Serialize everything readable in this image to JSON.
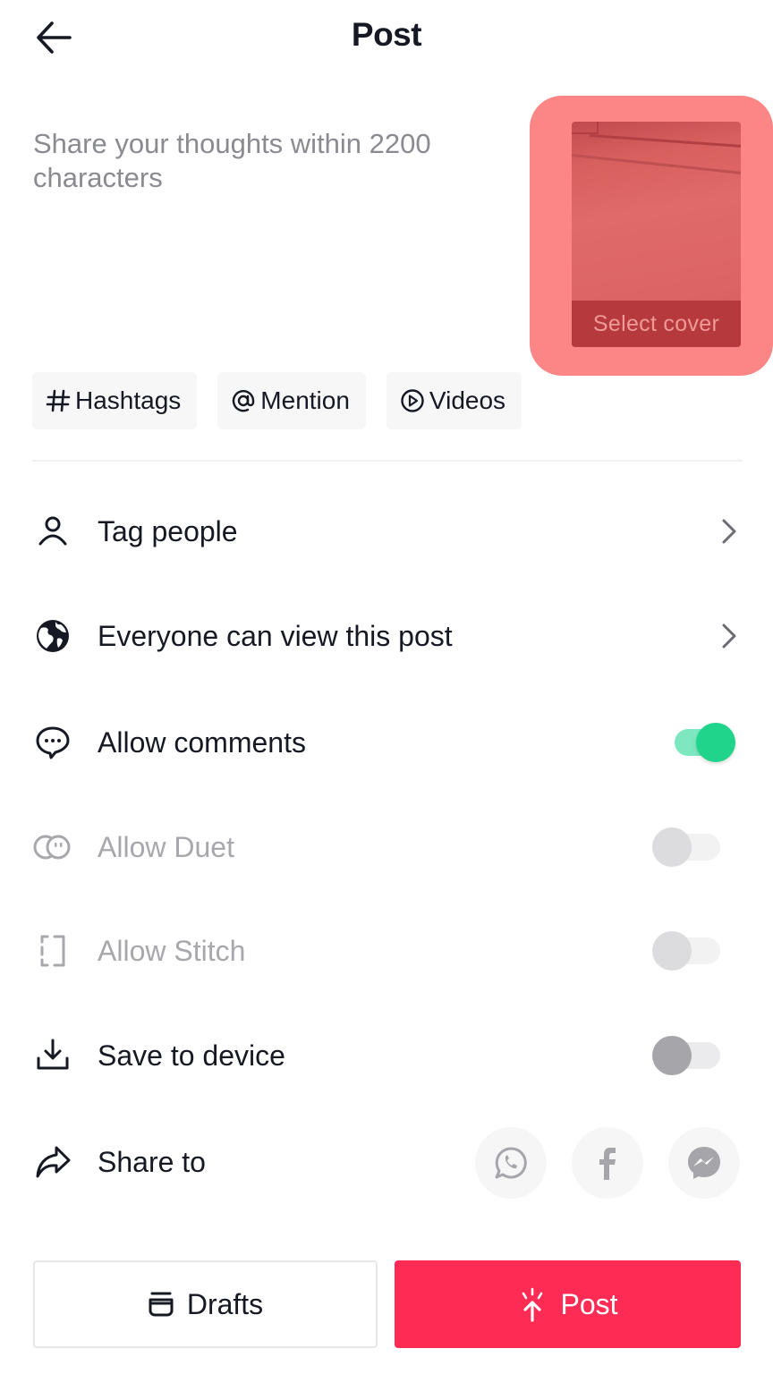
{
  "header": {
    "title": "Post",
    "back_icon": "arrow-left-icon"
  },
  "caption": {
    "placeholder": "Share your thoughts within 2200 characters",
    "value": ""
  },
  "cover": {
    "label": "Select cover",
    "highlight_color": "#fc8585"
  },
  "chips": [
    {
      "icon": "hashtag-icon",
      "label": "Hashtags"
    },
    {
      "icon": "at-icon",
      "label": "Mention"
    },
    {
      "icon": "play-circle-icon",
      "label": "Videos"
    }
  ],
  "settings": [
    {
      "icon": "person-icon",
      "label": "Tag people",
      "type": "link"
    },
    {
      "icon": "globe-icon",
      "label": "Everyone can view this post",
      "type": "link"
    },
    {
      "icon": "comment-icon",
      "label": "Allow comments",
      "type": "toggle",
      "state": "on",
      "disabled": false
    },
    {
      "icon": "duet-icon",
      "label": "Allow Duet",
      "type": "toggle",
      "state": "off",
      "disabled": true
    },
    {
      "icon": "stitch-icon",
      "label": "Allow Stitch",
      "type": "toggle",
      "state": "off",
      "disabled": true
    },
    {
      "icon": "download-icon",
      "label": "Save to device",
      "type": "toggle",
      "state": "off",
      "disabled": false
    },
    {
      "icon": "share-icon",
      "label": "Share to",
      "type": "share"
    }
  ],
  "share_targets": [
    {
      "icon": "whatsapp-icon",
      "name": "WhatsApp"
    },
    {
      "icon": "facebook-icon",
      "name": "Facebook"
    },
    {
      "icon": "messenger-icon",
      "name": "Messenger"
    }
  ],
  "footer": {
    "drafts_label": "Drafts",
    "post_label": "Post"
  },
  "colors": {
    "accent": "#fe2c55",
    "toggle_on": "#20d58b",
    "text_primary": "#161823",
    "text_placeholder": "#8a8b91"
  }
}
